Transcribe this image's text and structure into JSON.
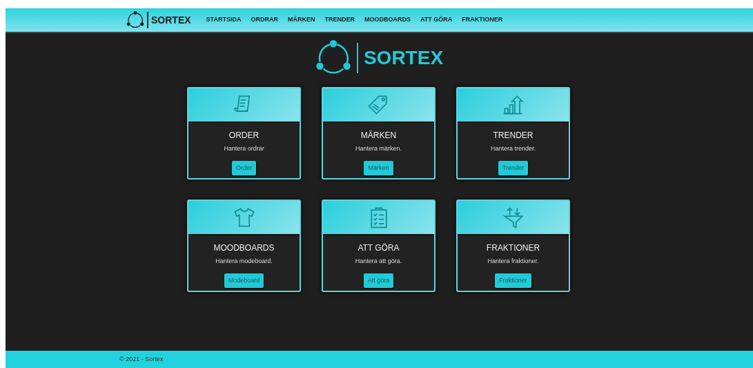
{
  "navbar": {
    "brand": "SORTEX",
    "links": [
      {
        "label": "STARTSIDA"
      },
      {
        "label": "ORDRAR"
      },
      {
        "label": "MÄRKEN"
      },
      {
        "label": "TRENDER"
      },
      {
        "label": "MOODBOARDS"
      },
      {
        "label": "ATT GÖRA"
      },
      {
        "label": "FRAKTIONER"
      }
    ]
  },
  "hero": {
    "brand": "SORTEX"
  },
  "cards": [
    {
      "title": "ORDER",
      "text": "Hantera ordrar",
      "button": "Order"
    },
    {
      "title": "MÄRKEN",
      "text": "Hantera märken.",
      "button": "Märken"
    },
    {
      "title": "TRENDER",
      "text": "Hantera trender.",
      "button": "Trender"
    },
    {
      "title": "MOODBOARDS",
      "text": "Hantera modeboard.",
      "button": "Modeboard"
    },
    {
      "title": "ATT GÖRA",
      "text": "Hantera att göra.",
      "button": "Att göra"
    },
    {
      "title": "FRAKTIONER",
      "text": "Hantera fraktioner.",
      "button": "Fraktioner"
    }
  ],
  "footer": {
    "text": "© 2021 - Sortex"
  }
}
